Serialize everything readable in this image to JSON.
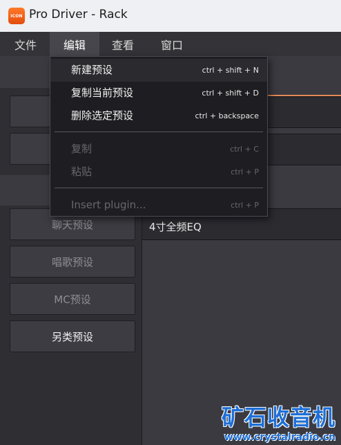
{
  "window": {
    "title": "Pro Driver - Rack",
    "icon_text": "ICON"
  },
  "menubar": {
    "items": [
      "文件",
      "编辑",
      "查看",
      "窗口"
    ],
    "active_index": 1
  },
  "edit_menu": {
    "items": [
      {
        "label": "新建预设",
        "shortcut": "ctrl + shift + N",
        "enabled": true
      },
      {
        "label": "复制当前预设",
        "shortcut": "ctrl + shift + D",
        "enabled": true
      },
      {
        "label": "删除选定预设",
        "shortcut": "ctrl + backspace",
        "enabled": true
      },
      {
        "label": "复制",
        "shortcut": "ctrl + C",
        "enabled": false
      },
      {
        "label": "粘贴",
        "shortcut": "ctrl + P",
        "enabled": false
      },
      {
        "label": "Insert plugin...",
        "shortcut": "ctrl + P",
        "enabled": false
      }
    ]
  },
  "presets": [
    "聊天预设",
    "唱歌预设",
    "MC预设",
    "另类预设"
  ],
  "plugin": {
    "name": "4寸全频EQ"
  },
  "watermark": {
    "text": "矿石收音机",
    "url": "www.crystalradio.cn"
  },
  "colors": {
    "accent": "#e58b58",
    "watermark": "#1e6fd6"
  }
}
